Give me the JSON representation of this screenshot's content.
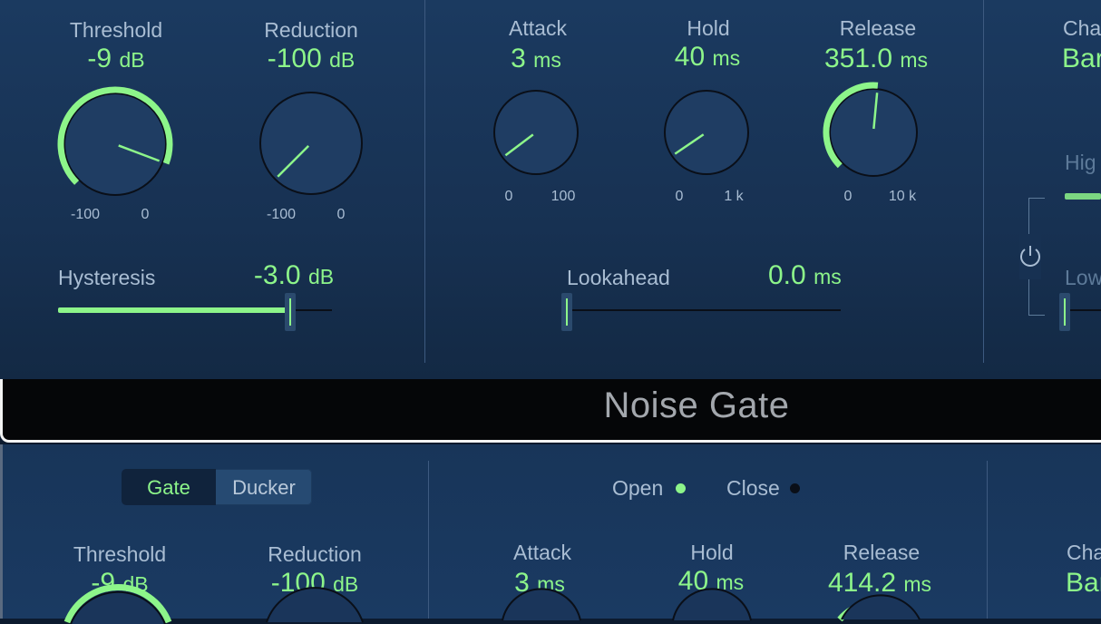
{
  "top": {
    "threshold": {
      "label": "Threshold",
      "value": "-9",
      "unit": "dB",
      "min": "-100",
      "max": "0",
      "level": 0.91
    },
    "reduction": {
      "label": "Reduction",
      "value": "-100",
      "unit": "dB",
      "min": "-100",
      "max": "0",
      "level": 0.0
    },
    "attack": {
      "label": "Attack",
      "value": "3",
      "unit": "ms",
      "min": "0",
      "max": "100",
      "level": 0.03
    },
    "hold": {
      "label": "Hold",
      "value": "40",
      "unit": "ms",
      "min": "0",
      "max": "1 k",
      "level": 0.04
    },
    "release": {
      "label": "Release",
      "value": "351.0",
      "unit": "ms",
      "min": "0",
      "max": "10 k",
      "level": 0.52
    },
    "hysteresis": {
      "label": "Hysteresis",
      "value": "-3.0",
      "unit": "dB",
      "level": 0.85
    },
    "lookahead": {
      "label": "Lookahead",
      "value": "0.0",
      "unit": "ms",
      "level": 0.0
    },
    "sidechain": {
      "label": "Cha",
      "value": "Bar",
      "high_label": "Hig",
      "low_label": "Low"
    }
  },
  "title": "Noise Gate",
  "bottom": {
    "mode_gate": "Gate",
    "mode_ducker": "Ducker",
    "open_label": "Open",
    "close_label": "Close",
    "threshold": {
      "label": "Threshold",
      "value": "-9",
      "unit": "dB"
    },
    "reduction": {
      "label": "Reduction",
      "value": "-100",
      "unit": "dB"
    },
    "attack": {
      "label": "Attack",
      "value": "3",
      "unit": "ms"
    },
    "hold": {
      "label": "Hold",
      "value": "40",
      "unit": "ms"
    },
    "release": {
      "label": "Release",
      "value": "414.2",
      "unit": "ms"
    },
    "sidechain": {
      "label": "Cha",
      "value": "Bar"
    }
  },
  "colors": {
    "accent": "#8df58a",
    "label": "#a9bdd3",
    "panel": "#173152",
    "led_off": "#0a0f18"
  }
}
